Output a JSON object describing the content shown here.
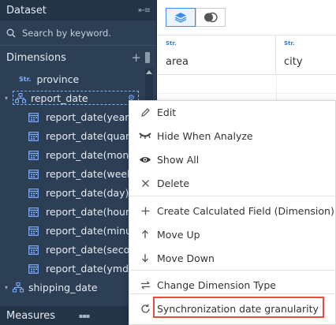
{
  "dataset": {
    "title": "Dataset",
    "search_placeholder": "Search by keyword."
  },
  "dimensions": {
    "title": "Dimensions",
    "add_symbol": "+",
    "items": [
      {
        "type": "Str.",
        "label": "province"
      },
      {
        "label": "report_date",
        "children": [
          "report_date(year)",
          "report_date(quarter)",
          "report_date(month)",
          "report_date(week)",
          "report_date(day)",
          "report_date(hour)",
          "report_date(minute)",
          "report_date(second)",
          "report_date(ymd)"
        ]
      },
      {
        "label": "shipping_date"
      }
    ]
  },
  "measures": {
    "title": "Measures"
  },
  "table": {
    "columns": [
      {
        "type": "Str.",
        "name": "area"
      },
      {
        "type": "Str.",
        "name": "city"
      }
    ]
  },
  "context_menu": {
    "items": [
      {
        "icon": "pencil-icon",
        "label": "Edit"
      },
      {
        "icon": "eye-slash-icon",
        "label": "Hide When Analyze"
      },
      {
        "icon": "eye-icon",
        "label": "Show All"
      },
      {
        "icon": "close-icon",
        "label": "Delete"
      },
      {
        "icon": "plus-icon",
        "label": "Create Calculated Field (Dimension)"
      },
      {
        "icon": "arrow-up-icon",
        "label": "Move Up"
      },
      {
        "icon": "arrow-down-icon",
        "label": "Move Down"
      },
      {
        "icon": "swap-icon",
        "label": "Change Dimension Type"
      },
      {
        "icon": "refresh-icon",
        "label": "Synchronization date granularity"
      }
    ]
  },
  "colors": {
    "sidebar_bg": "#2d3f55",
    "accent": "#3a8ee6",
    "highlight": "#e74c3c"
  }
}
